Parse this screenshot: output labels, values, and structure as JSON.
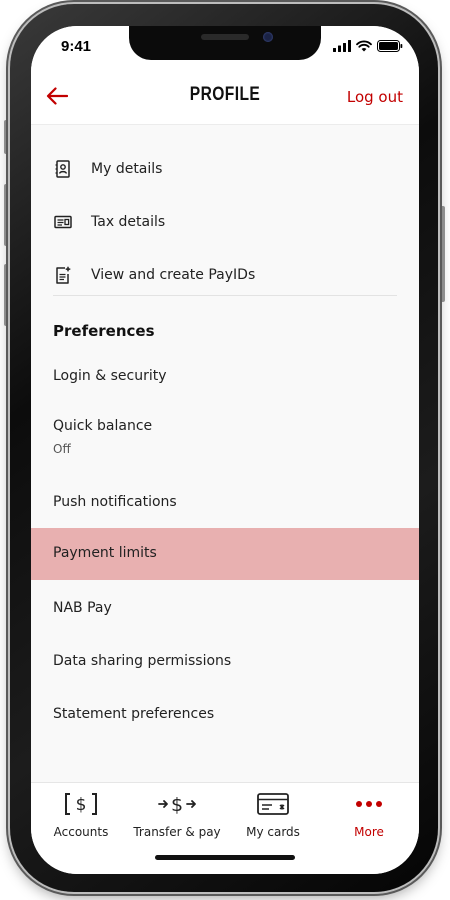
{
  "status_bar": {
    "time": "9:41"
  },
  "header": {
    "title": "PROFILE",
    "logout_label": "Log out"
  },
  "account_items": [
    {
      "label": "My details",
      "icon": "contact-card-icon"
    },
    {
      "label": "Tax details",
      "icon": "id-card-icon"
    },
    {
      "label": "View and create PayIDs",
      "icon": "document-add-icon"
    }
  ],
  "preferences": {
    "heading": "Preferences",
    "items": [
      {
        "label": "Login & security",
        "sub": ""
      },
      {
        "label": "Quick balance",
        "sub": "Off"
      },
      {
        "label": "Push notifications",
        "sub": ""
      },
      {
        "label": "Payment limits",
        "sub": "",
        "highlighted": true
      },
      {
        "label": "NAB Pay",
        "sub": ""
      },
      {
        "label": "Data sharing permissions",
        "sub": ""
      },
      {
        "label": "Statement preferences",
        "sub": ""
      }
    ]
  },
  "tab_bar": {
    "tabs": [
      {
        "label": "Accounts",
        "icon": "dollar-bracket-icon",
        "active": false
      },
      {
        "label": "Transfer & pay",
        "icon": "transfer-dollar-icon",
        "active": false
      },
      {
        "label": "My cards",
        "icon": "card-icon",
        "active": false
      },
      {
        "label": "More",
        "icon": "more-dots-icon",
        "active": true
      }
    ]
  },
  "colors": {
    "accent": "#c20000",
    "highlight": "#e8b0b0",
    "background": "#f9f9f9"
  }
}
